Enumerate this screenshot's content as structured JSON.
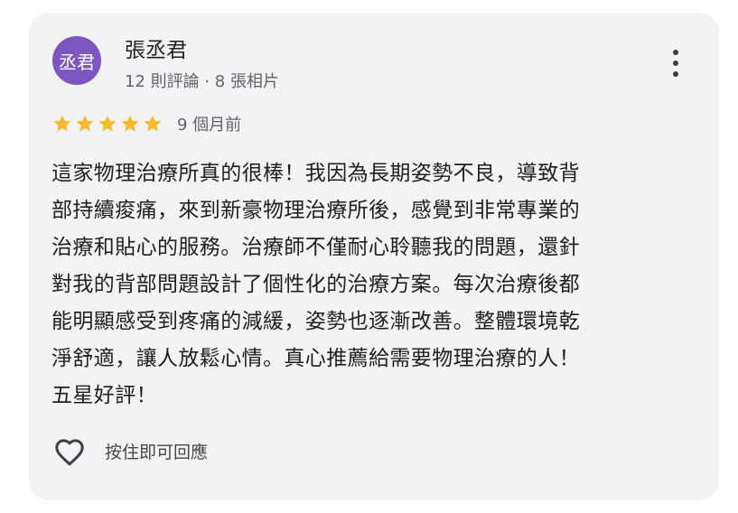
{
  "review": {
    "avatar_text": "丞君",
    "reviewer_name": "張丞君",
    "reviewer_meta": "12 則評論 · 8 張相片",
    "rating": 5,
    "rating_max": 5,
    "time_ago": "9 個月前",
    "text_lines": [
      "這家物理治療所真的很棒！我因為長期姿勢不良，導致背",
      "部持續痠痛，來到新豪物理治療所後，感覺到非常專業的",
      "治療和貼心的服務。治療師不僅耐心聆聽我的問題，還針",
      "對我的背部問題設計了個性化的治療方案。每次治療後都",
      "能明顯感受到疼痛的減緩，姿勢也逐漸改善。整體環境乾",
      "淨舒適，讓人放鬆心情。真心推薦給需要物理治療的人！",
      "五星好評！"
    ],
    "reply_hint": "按住即可回應"
  },
  "icons": {
    "star": "star-icon",
    "more": "more-vert-icon",
    "like": "heart-outline-icon"
  },
  "colors": {
    "card_bg": "#f3f3f6",
    "avatar_bg": "#7d57c1",
    "star": "#f6bb2c",
    "text": "#1f1f1f",
    "secondary_text": "#5f6368"
  }
}
